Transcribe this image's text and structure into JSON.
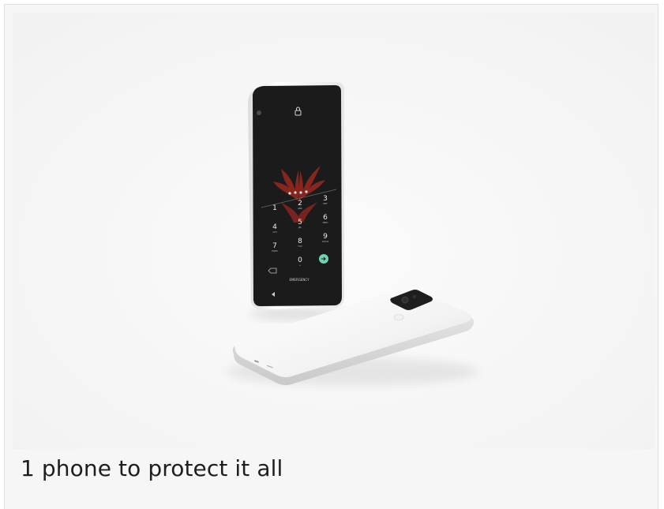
{
  "product_image": {
    "phone_ui": {
      "keypad": [
        {
          "digit": "1",
          "letters": ""
        },
        {
          "digit": "2",
          "letters": "ABC"
        },
        {
          "digit": "3",
          "letters": "DEF"
        },
        {
          "digit": "4",
          "letters": "GHI"
        },
        {
          "digit": "5",
          "letters": "JKL"
        },
        {
          "digit": "6",
          "letters": "MNO"
        },
        {
          "digit": "7",
          "letters": "PQRS"
        },
        {
          "digit": "8",
          "letters": "TUV"
        },
        {
          "digit": "9",
          "letters": "WXYZ"
        },
        {
          "digit": "0",
          "letters": "+"
        }
      ],
      "pin_entered_dots": 4,
      "emergency_label": "EMERGENCY",
      "enter_button_icon": "arrow-right-icon",
      "backspace_icon": "backspace-icon",
      "lock_icon": "lock-icon",
      "nav_back_icon": "back-triangle-icon",
      "wallpaper_logo": "red phoenix logo"
    },
    "colors": {
      "background": "#f6f6f6",
      "phone_body": "#ffffff",
      "screen": "#1b1b1c",
      "logo": "#8f2620",
      "enter_button": "#6fd3b2"
    }
  },
  "caption": "1 phone to protect it all"
}
